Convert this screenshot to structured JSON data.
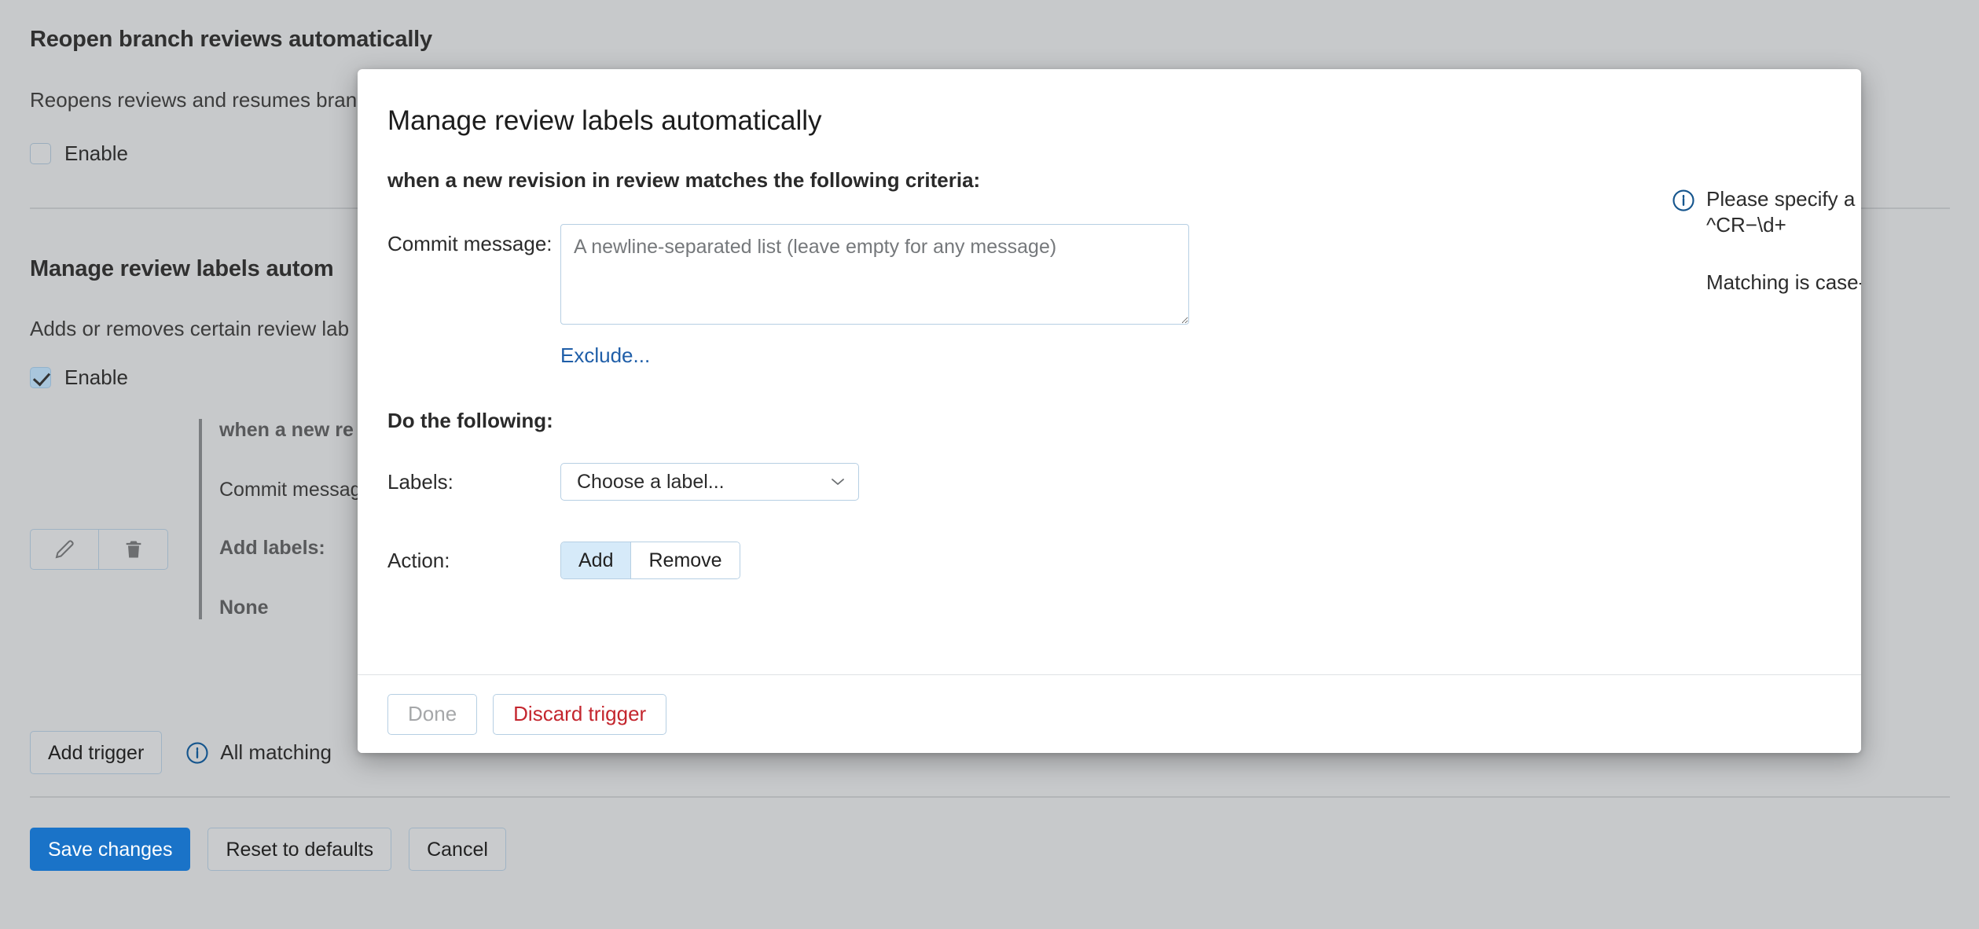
{
  "background": {
    "section_one": {
      "title": "Reopen branch reviews automatically",
      "description": "Reopens reviews and resumes bran",
      "enable_label": "Enable",
      "enabled": false
    },
    "section_two": {
      "title": "Manage review labels autom",
      "description": "Adds or removes certain review lab",
      "enable_label": "Enable",
      "enabled": true
    },
    "trigger_card": {
      "heading": "when a new re",
      "commit_label": "Commit messag",
      "add_labels_label": "Add labels:",
      "add_labels_value": "None"
    },
    "tools": {
      "edit_icon": "pencil-icon",
      "delete_icon": "trash-icon"
    },
    "add_trigger_label": "Add trigger",
    "info_note": "All matching",
    "info_icon": "info-circle-icon",
    "footer": {
      "save_label": "Save changes",
      "reset_label": "Reset to defaults",
      "cancel_label": "Cancel"
    }
  },
  "modal": {
    "title": "Manage review labels automatically",
    "subtitle": "when a new revision in review matches the following criteria:",
    "commit": {
      "label": "Commit message:",
      "value": "",
      "placeholder": "A newline-separated list (leave empty for any message)",
      "exclude_link": "Exclude..."
    },
    "hint": {
      "icon": "info-circle-icon",
      "text": "Please specify a regular expression, for example:",
      "example": "^CR−\\d+",
      "note": "Matching is case-insensitive."
    },
    "do_heading": "Do the following:",
    "labels": {
      "label": "Labels:",
      "selected": "Choose a label...",
      "chevron": "chevron-down-icon"
    },
    "action": {
      "label": "Action:",
      "options": [
        "Add",
        "Remove"
      ],
      "selected": "Add"
    },
    "footer": {
      "done_label": "Done",
      "discard_label": "Discard trigger"
    }
  },
  "colors": {
    "accent_blue": "#1a73c8",
    "link_blue": "#1f5ea8",
    "danger_red": "#c4262e",
    "page_bg": "#c7c9cb",
    "selected_seg": "#d6eaf9"
  }
}
